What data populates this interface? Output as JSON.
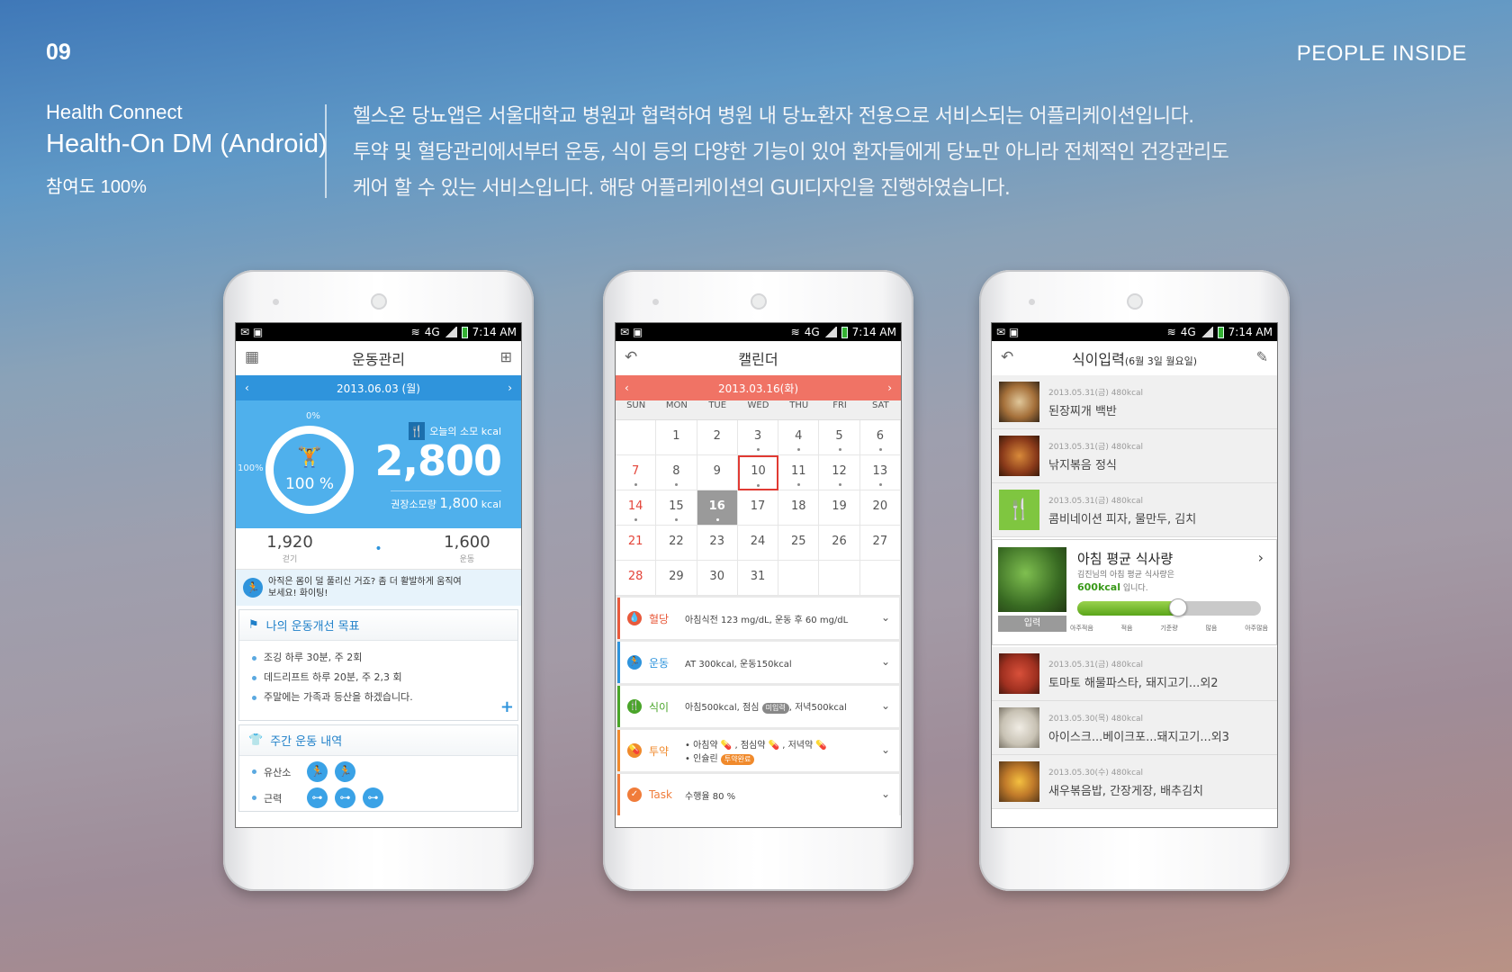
{
  "page": {
    "number": "09",
    "brand": "PEOPLE INSIDE",
    "client": "Health Connect",
    "title": "Health-On DM (Android)",
    "participation": "참여도 100%",
    "description": [
      "헬스온 당뇨앱은 서울대학교 병원과 협력하여 병원 내 당뇨환자 전용으로 서비스되는 어플리케이션입니다.",
      "투약 및 혈당관리에서부터 운동, 식이 등의 다양한 기능이 있어 환자들에게 당뇨만 아니라 전체적인 건강관리도",
      "케어 할 수 있는 서비스입니다. 해당 어플리케이션의 GUI디자인을 진행하였습니다."
    ]
  },
  "status": {
    "time": "7:14 AM",
    "network": "4G"
  },
  "exercise": {
    "title": "운동관리",
    "date": "2013.06.03 (월)",
    "ring_top": "0%",
    "ring_left": "100%",
    "ring_value": "100 %",
    "progress": 1.0,
    "burn_label": "오늘의 소모 kcal",
    "burn_value": "2,800",
    "rec_label": "권장소모량",
    "rec_value": "1,800",
    "rec_unit": "kcal",
    "stats": [
      {
        "value": "1,920",
        "label": "걷기"
      },
      {
        "value": "1,600",
        "label": "운동"
      }
    ],
    "tip": [
      "아직은 몸이 덜 풀리신 거죠? 좀 더 활발하게 움직여",
      "보세요! 화이팅!"
    ],
    "goals_title": "나의 운동개선 목표",
    "goals": [
      "조깅 하루 30분, 주 2회",
      "데드리프트 하루 20분, 주 2,3 회",
      "주말에는 가족과 등산을 하겠습니다."
    ],
    "weekly_title": "주간 운동 내역",
    "weekly": [
      {
        "label": "유산소",
        "count": 2
      },
      {
        "label": "근력",
        "count": 3
      }
    ]
  },
  "calendar": {
    "title": "캘린더",
    "month": "2013.03.16(화)",
    "weekdays": [
      "SUN",
      "MON",
      "TUE",
      "WED",
      "THU",
      "FRI",
      "SAT"
    ],
    "days": [
      "",
      "1",
      "2",
      "3",
      "4",
      "5",
      "6",
      "7",
      "8",
      "9",
      "10",
      "11",
      "12",
      "13",
      "14",
      "15",
      "16",
      "17",
      "18",
      "19",
      "20",
      "21",
      "22",
      "23",
      "24",
      "25",
      "26",
      "27",
      "28",
      "29",
      "30",
      "31",
      "",
      "",
      ""
    ],
    "rows": [
      {
        "label": "혈당",
        "text": "아침식전 123 mg/dL, 운동 후 60 mg/dL",
        "color": "#e85a3c"
      },
      {
        "label": "운동",
        "text": "AT 300kcal, 운동150kcal",
        "color": "#2f94dc"
      },
      {
        "label": "식이",
        "text": "아침500kcal, 점심",
        "pill": "미입력",
        "text2": ", 저녁500kcal",
        "color": "#4aa52a"
      },
      {
        "label": "투약",
        "line1": "• 아침약 💊 , 점심약 💊 , 저녁약 💊",
        "line2": "• 인슐린",
        "pill": "투약완료",
        "color": "#f08a2c"
      },
      {
        "label": "Task",
        "text": "수행율 80 %",
        "color": "#f07c3a"
      }
    ]
  },
  "diet": {
    "title": "식이입력",
    "title_sub": "(6월 3일 월요일)",
    "meals_top": [
      {
        "meta": "2013.05.31(금) 480kcal",
        "name": "된장찌개 백반"
      },
      {
        "meta": "2013.05.31(금) 480kcal",
        "name": "낚지볶음 정식"
      },
      {
        "meta": "2013.05.31(금) 480kcal",
        "name": "콤비네이션 피자, 물만두, 김치"
      }
    ],
    "avg_title": "아침 평균 식사량",
    "avg_sub": "김진님의 아침 평균 식사량은",
    "avg_value": "600kcal",
    "avg_suffix": "입니다.",
    "avg_button": "입력",
    "avg_level": 0.55,
    "scale": [
      "아주적음",
      "적음",
      "기준량",
      "많음",
      "아주많음"
    ],
    "meals_bottom": [
      {
        "meta": "2013.05.31(금) 480kcal",
        "name": "토마토 해물파스타, 돼지고기...외2"
      },
      {
        "meta": "2013.05.30(목) 480kcal",
        "name": "아이스크...베이크포...돼지고기...외3"
      },
      {
        "meta": "2013.05.30(수) 480kcal",
        "name": "새우볶음밥, 간장게장, 배추김치"
      }
    ]
  },
  "colors": {
    "primary": "#2f94dc",
    "hero": "#4fb0ec",
    "calendar_accent": "#f07365",
    "diet_green": "#5aa519"
  }
}
